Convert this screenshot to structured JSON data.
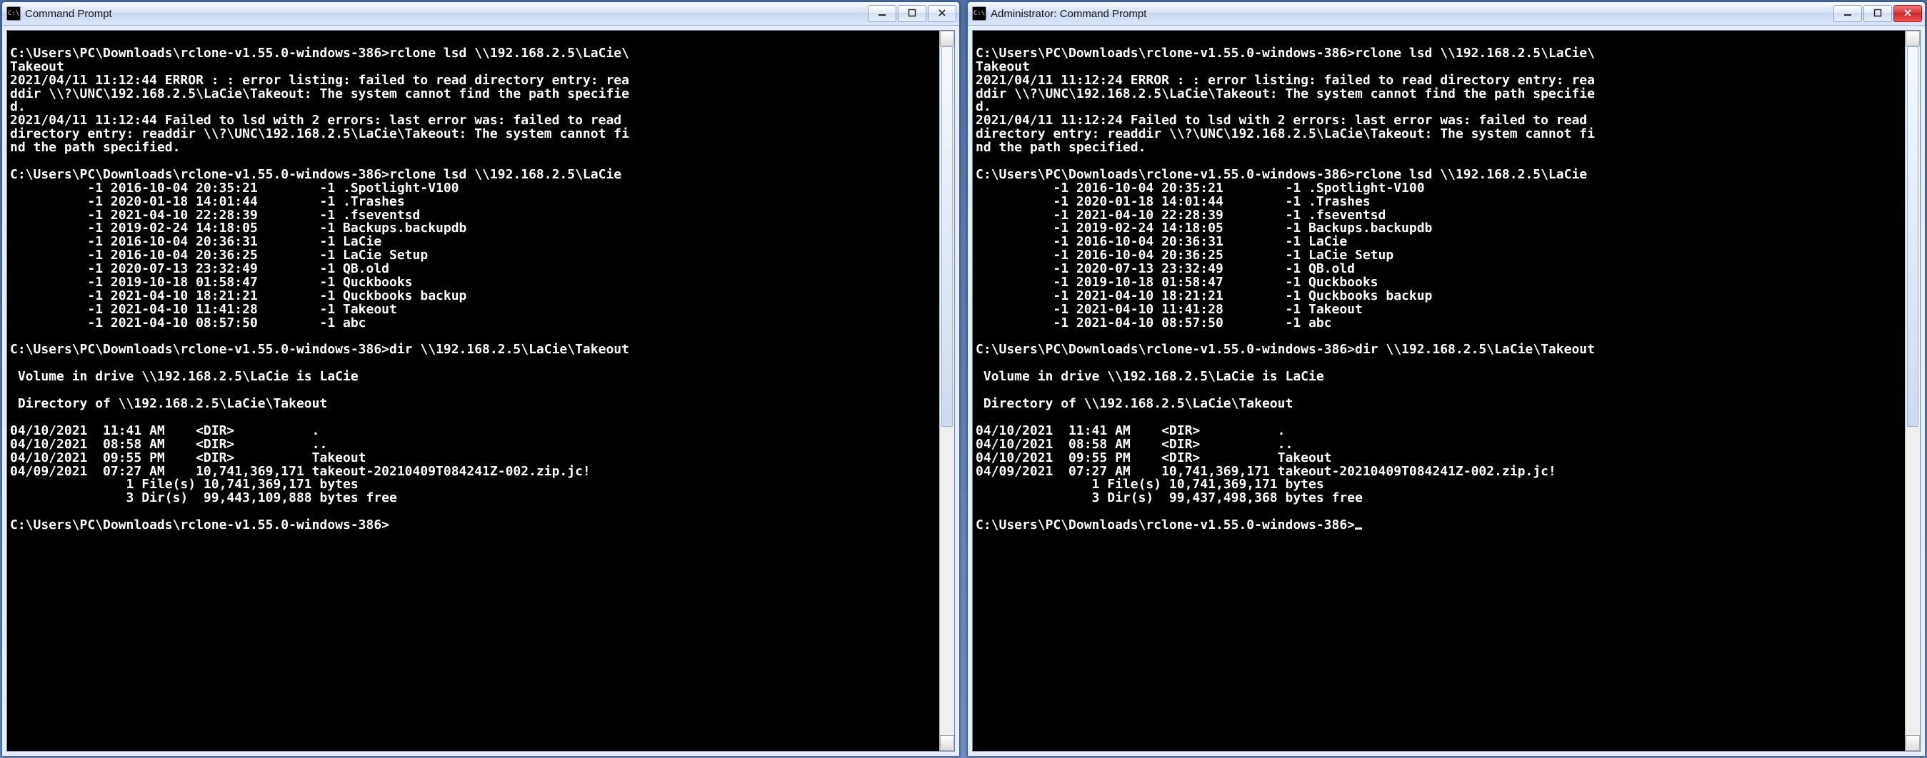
{
  "windows": [
    {
      "title": "Command Prompt",
      "close_style": "normal",
      "scrollbar": {
        "thumb_top_pct": 0,
        "thumb_height_pct": 55
      },
      "trailing_cursor": false,
      "lines": [
        "",
        "C:\\Users\\PC\\Downloads\\rclone-v1.55.0-windows-386>rclone lsd \\\\192.168.2.5\\LaCie\\",
        "Takeout",
        "2021/04/11 11:12:44 ERROR : : error listing: failed to read directory entry: rea",
        "ddir \\\\?\\UNC\\192.168.2.5\\LaCie\\Takeout: The system cannot find the path specifie",
        "d.",
        "2021/04/11 11:12:44 Failed to lsd with 2 errors: last error was: failed to read ",
        "directory entry: readdir \\\\?\\UNC\\192.168.2.5\\LaCie\\Takeout: The system cannot fi",
        "nd the path specified.",
        "",
        "C:\\Users\\PC\\Downloads\\rclone-v1.55.0-windows-386>rclone lsd \\\\192.168.2.5\\LaCie",
        "          -1 2016-10-04 20:35:21        -1 .Spotlight-V100",
        "          -1 2020-01-18 14:01:44        -1 .Trashes",
        "          -1 2021-04-10 22:28:39        -1 .fseventsd",
        "          -1 2019-02-24 14:18:05        -1 Backups.backupdb",
        "          -1 2016-10-04 20:36:31        -1 LaCie",
        "          -1 2016-10-04 20:36:25        -1 LaCie Setup",
        "          -1 2020-07-13 23:32:49        -1 QB.old",
        "          -1 2019-10-18 01:58:47        -1 Quckbooks",
        "          -1 2021-04-10 18:21:21        -1 Quckbooks backup",
        "          -1 2021-04-10 11:41:28        -1 Takeout",
        "          -1 2021-04-10 08:57:50        -1 abc",
        "",
        "C:\\Users\\PC\\Downloads\\rclone-v1.55.0-windows-386>dir \\\\192.168.2.5\\LaCie\\Takeout",
        "",
        " Volume in drive \\\\192.168.2.5\\LaCie is LaCie",
        "",
        " Directory of \\\\192.168.2.5\\LaCie\\Takeout",
        "",
        "04/10/2021  11:41 AM    <DIR>          .",
        "04/10/2021  08:58 AM    <DIR>          ..",
        "04/10/2021  09:55 PM    <DIR>          Takeout",
        "04/09/2021  07:27 AM    10,741,369,171 takeout-20210409T084241Z-002.zip.jc!",
        "               1 File(s) 10,741,369,171 bytes",
        "               3 Dir(s)  99,443,109,888 bytes free",
        "",
        "C:\\Users\\PC\\Downloads\\rclone-v1.55.0-windows-386>"
      ]
    },
    {
      "title": "Administrator: Command Prompt",
      "close_style": "red",
      "scrollbar": {
        "thumb_top_pct": 0,
        "thumb_height_pct": 55
      },
      "trailing_cursor": true,
      "lines": [
        "",
        "C:\\Users\\PC\\Downloads\\rclone-v1.55.0-windows-386>rclone lsd \\\\192.168.2.5\\LaCie\\",
        "Takeout",
        "2021/04/11 11:12:24 ERROR : : error listing: failed to read directory entry: rea",
        "ddir \\\\?\\UNC\\192.168.2.5\\LaCie\\Takeout: The system cannot find the path specifie",
        "d.",
        "2021/04/11 11:12:24 Failed to lsd with 2 errors: last error was: failed to read ",
        "directory entry: readdir \\\\?\\UNC\\192.168.2.5\\LaCie\\Takeout: The system cannot fi",
        "nd the path specified.",
        "",
        "C:\\Users\\PC\\Downloads\\rclone-v1.55.0-windows-386>rclone lsd \\\\192.168.2.5\\LaCie",
        "          -1 2016-10-04 20:35:21        -1 .Spotlight-V100",
        "          -1 2020-01-18 14:01:44        -1 .Trashes",
        "          -1 2021-04-10 22:28:39        -1 .fseventsd",
        "          -1 2019-02-24 14:18:05        -1 Backups.backupdb",
        "          -1 2016-10-04 20:36:31        -1 LaCie",
        "          -1 2016-10-04 20:36:25        -1 LaCie Setup",
        "          -1 2020-07-13 23:32:49        -1 QB.old",
        "          -1 2019-10-18 01:58:47        -1 Quckbooks",
        "          -1 2021-04-10 18:21:21        -1 Quckbooks backup",
        "          -1 2021-04-10 11:41:28        -1 Takeout",
        "          -1 2021-04-10 08:57:50        -1 abc",
        "",
        "C:\\Users\\PC\\Downloads\\rclone-v1.55.0-windows-386>dir \\\\192.168.2.5\\LaCie\\Takeout",
        "",
        " Volume in drive \\\\192.168.2.5\\LaCie is LaCie",
        "",
        " Directory of \\\\192.168.2.5\\LaCie\\Takeout",
        "",
        "04/10/2021  11:41 AM    <DIR>          .",
        "04/10/2021  08:58 AM    <DIR>          ..",
        "04/10/2021  09:55 PM    <DIR>          Takeout",
        "04/09/2021  07:27 AM    10,741,369,171 takeout-20210409T084241Z-002.zip.jc!",
        "               1 File(s) 10,741,369,171 bytes",
        "               3 Dir(s)  99,437,498,368 bytes free",
        "",
        "C:\\Users\\PC\\Downloads\\rclone-v1.55.0-windows-386>"
      ]
    }
  ],
  "icons": {
    "app": "C:\\",
    "min": "—",
    "max": "◻",
    "close": "✕",
    "up": "▲",
    "down": "▼"
  }
}
